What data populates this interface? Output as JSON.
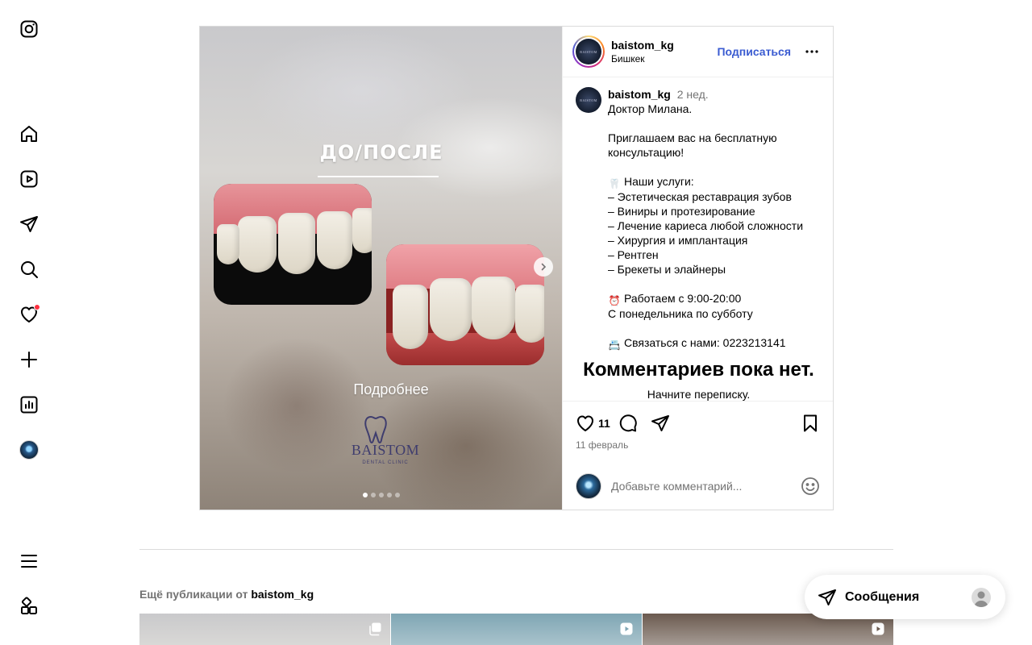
{
  "post": {
    "username": "baistom_kg",
    "location": "Бишкек",
    "follow_label": "Подписаться",
    "caption_time": "2 нед.",
    "caption_lines": [
      "Доктор Милана.",
      "",
      "Приглашаем вас на бесплатную",
      "консультацию!",
      "",
      "Наши услуги:",
      "– Эстетическая реставрация зубов",
      "– Виниры и протезирование",
      "– Лечение кариеса любой сложности",
      "– Хирургия и имплантация",
      "– Рентген",
      "– Брекеты и элайнеры",
      "",
      "Работаем с 9:00-20:00",
      "С понедельника по субботу",
      "",
      "Связаться с нами: 0223213141"
    ],
    "no_comments": "Комментариев пока нет.",
    "start_conversation": "Начните переписку.",
    "likes": "11",
    "date": "11 февраль",
    "comment_placeholder": "Добавьте комментарий...",
    "image": {
      "title": "ДО/ПОСЛЕ",
      "more": "Подробнее",
      "brand_name": "BAISTOM",
      "brand_sub": "DENTAL CLINIC",
      "logo_text": "BAISTOM",
      "slide_count": 5,
      "active_slide": 1
    }
  },
  "more_publications": {
    "prefix": "Ещё публикации от",
    "username": "baistom_kg"
  },
  "messages": {
    "label": "Сообщения"
  },
  "icons": {
    "rail": [
      "instagram-icon",
      "home-icon",
      "reels-icon",
      "direct-icon",
      "search-icon",
      "heart-icon",
      "create-icon",
      "dashboard-icon",
      "profile-avatar",
      "menu-icon",
      "more-apps-icon"
    ],
    "emoji_services": "tooth-icon",
    "emoji_hours": "alarm-clock-icon",
    "emoji_contact": "phone-book-icon"
  },
  "colors": {
    "follow": "#3a5bd1",
    "notification": "#ff3040",
    "brand": "#3f3d6e"
  }
}
